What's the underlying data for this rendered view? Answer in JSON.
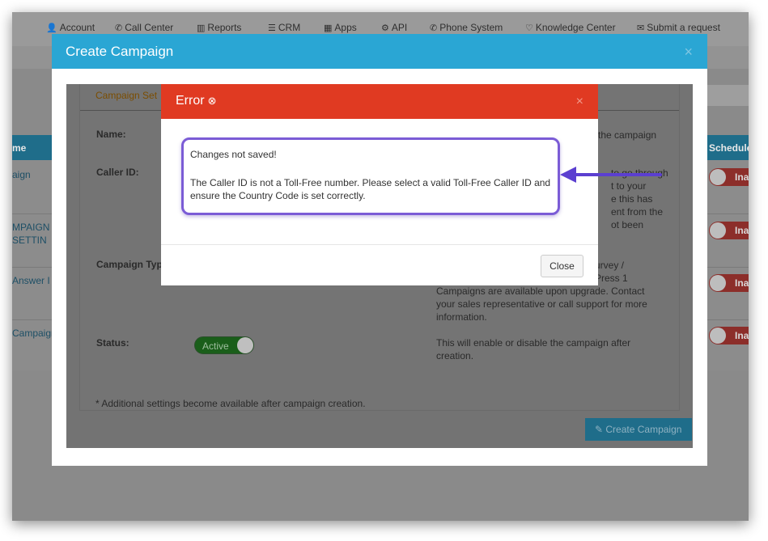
{
  "nav": {
    "items": [
      {
        "icon": "user-icon",
        "glyph": "👤",
        "label": "Account"
      },
      {
        "icon": "phone-icon",
        "glyph": "✆",
        "label": "Call Center"
      },
      {
        "icon": "bar-chart-icon",
        "glyph": "▥",
        "label": "Reports"
      },
      {
        "icon": "list-icon",
        "glyph": "☰",
        "label": "CRM"
      },
      {
        "icon": "grid-icon",
        "glyph": "▦",
        "label": "Apps"
      },
      {
        "icon": "gear-icon",
        "glyph": "⚙",
        "label": "API"
      },
      {
        "icon": "phone-icon",
        "glyph": "✆",
        "label": "Phone System"
      },
      {
        "icon": "lightbulb-icon",
        "glyph": "♡",
        "label": "Knowledge Center"
      },
      {
        "icon": "comment-icon",
        "glyph": "✉",
        "label": "Submit a request"
      }
    ]
  },
  "background_table": {
    "left_header": "me",
    "right_header": "Schedule",
    "left_cells": [
      "aign",
      "MPAIGN -",
      "SETTIN",
      "Answer I",
      "Campaign"
    ],
    "toggle_label": "Ina"
  },
  "create_modal": {
    "title": "Create Campaign",
    "close": "×",
    "tab_label": "Campaign Set",
    "labels": {
      "name": "Name:",
      "caller_id": "Caller ID:",
      "campaign_type": "Campaign Typ",
      "status": "Status:"
    },
    "help": {
      "name": "the campaign",
      "caller_id": [
        "to go through",
        "t to your",
        "e this has",
        "ent from the",
        "ot been"
      ],
      "campaign_type": [
        "urvey /",
        "Press 1",
        "Campaigns are available upon upgrade. Contact",
        "your sales representative or call support for more",
        "information."
      ],
      "status": [
        "This will enable or disable the campaign after",
        "creation."
      ]
    },
    "status_value": "Active",
    "foot_note": "* Additional settings become available after campaign creation.",
    "create_button": "Create Campaign"
  },
  "error_modal": {
    "title": "Error",
    "title_icon": "⊗",
    "close": "×",
    "message_line1": "Changes not saved!",
    "message_line2": "The Caller ID is not a Toll-Free number. Please select a valid Toll-Free Caller ID and ensure the Country Code is set correctly.",
    "close_button": "Close"
  },
  "colors": {
    "modal_header": "#2aa6d4",
    "error_header": "#e03a22",
    "highlight_border": "#7b5cd6",
    "arrow": "#5b3fd0"
  }
}
